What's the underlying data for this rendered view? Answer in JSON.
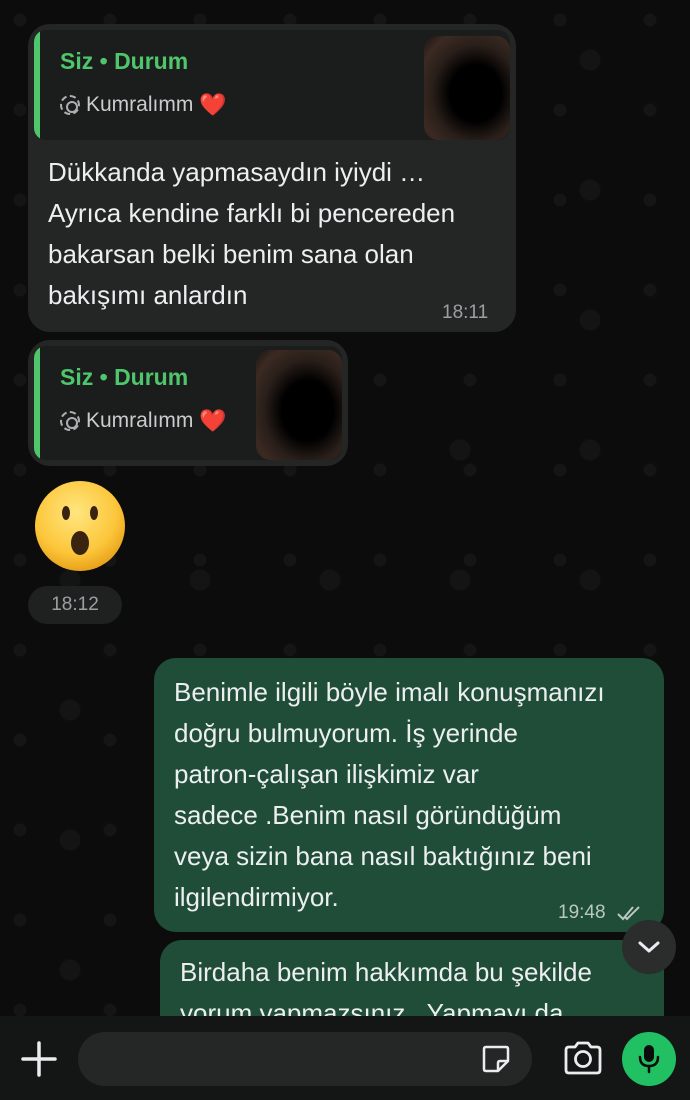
{
  "messages": {
    "m1": {
      "reply_author": "Siz • Durum",
      "reply_sub": "Kumralımm",
      "text_lines": [
        "Dükkanda yapmasaydın iyiydi  …",
        "Ayrıca kendine farklı bi pencereden",
        "bakarsan belki benim sana olan",
        "bakışımı anlardın"
      ],
      "time": "18:11"
    },
    "m2": {
      "reply_author": "Siz • Durum",
      "reply_sub": "Kumralımm",
      "emoji": "😮",
      "emoji_name": "astonished-face-icon",
      "time": "18:12"
    },
    "m3": {
      "text_lines": [
        "Benimle ilgili böyle imalı konuşmanızı",
        "doğru bulmuyorum. İş yerinde",
        "patron-çalışan ilişkimiz var",
        "sadece .Benim nasıl göründüğüm",
        "veya sizin bana nasıl baktığınız beni",
        "ilgilendirmiyor."
      ],
      "time": "19:48",
      "status": "read"
    },
    "m4": {
      "text_lines": [
        "Birdaha benim hakkımda bu şekilde",
        "yorum yapmazsınız . Yapmayı da"
      ]
    }
  },
  "heart": "❤️",
  "input": {
    "placeholder": "",
    "value": ""
  },
  "icons": {
    "plus": "plus-icon",
    "sticker": "sticker-icon",
    "camera": "camera-icon",
    "mic": "microphone-icon",
    "scroll": "chevron-down-icon"
  },
  "colors": {
    "accent": "#4fc66b",
    "mic": "#21c063",
    "incoming": "#242626",
    "outgoing": "#1f4d38"
  }
}
